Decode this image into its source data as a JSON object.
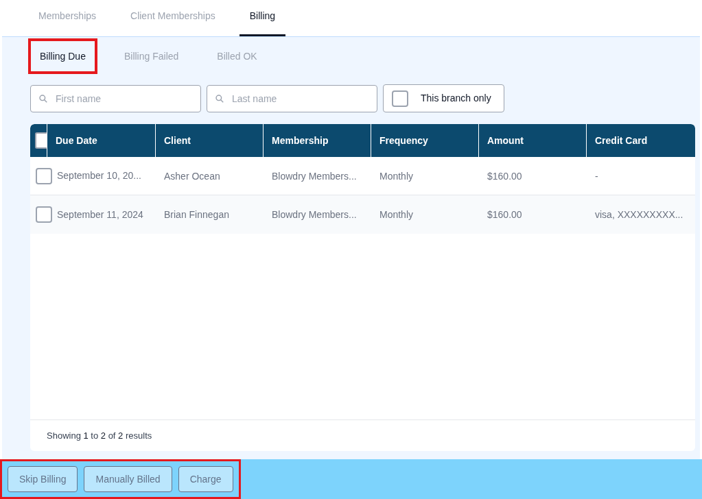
{
  "tabs": [
    {
      "label": "Memberships",
      "selected": false
    },
    {
      "label": "Client Memberships",
      "selected": false
    },
    {
      "label": "Billing",
      "selected": true
    }
  ],
  "subtabs": [
    {
      "label": "Billing Due",
      "selected": true,
      "highlighted": true
    },
    {
      "label": "Billing Failed",
      "selected": false,
      "highlighted": false
    },
    {
      "label": "Billed OK",
      "selected": false,
      "highlighted": false
    }
  ],
  "filters": {
    "first_name": {
      "placeholder": "First name"
    },
    "last_name": {
      "placeholder": "Last name"
    },
    "branch_only": {
      "label": "This branch only",
      "checked": false
    }
  },
  "table": {
    "select_all_checked": false,
    "columns": [
      "Due Date",
      "Client",
      "Membership",
      "Frequency",
      "Amount",
      "Credit Card"
    ],
    "rows": [
      {
        "checked": false,
        "cells": [
          "September 10, 20...",
          "Asher Ocean",
          "Blowdry Members...",
          "Monthly",
          "$160.00",
          "-"
        ]
      },
      {
        "checked": false,
        "cells": [
          "September 11, 2024",
          "Brian Finnegan",
          "Blowdry Members...",
          "Monthly",
          "$160.00",
          "visa, XXXXXXXXX..."
        ]
      }
    ],
    "footer": "Showing **1** to **2** of **2** results"
  },
  "actions": {
    "highlighted": true,
    "buttons": [
      {
        "label": "Skip Billing",
        "disabled": true
      },
      {
        "label": "Manually Billed",
        "disabled": true
      },
      {
        "label": "Charge",
        "disabled": true
      }
    ]
  }
}
